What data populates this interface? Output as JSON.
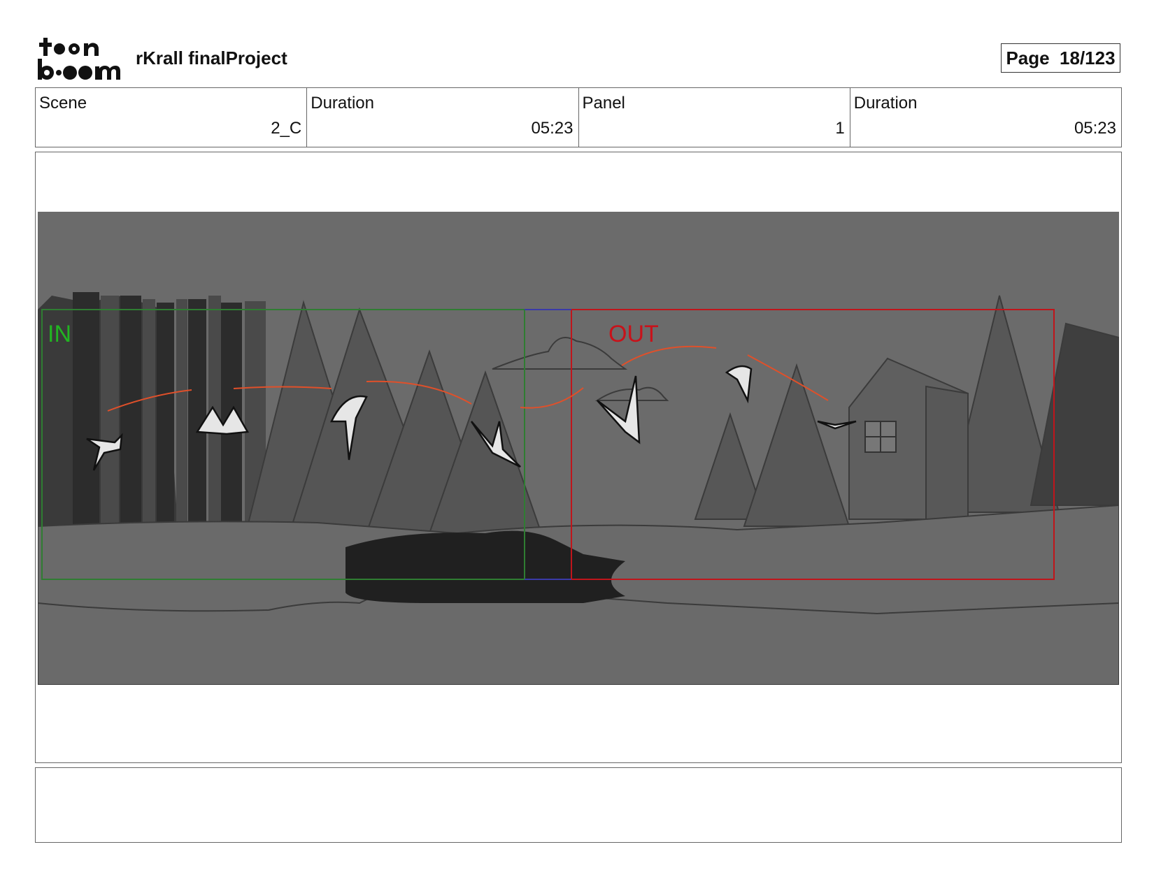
{
  "header": {
    "project_title": "rKrall finalProject",
    "page_label": "Page  18/123",
    "logo_text": "toonboom"
  },
  "info": [
    {
      "label": "Scene",
      "value": "2_C"
    },
    {
      "label": "Duration",
      "value": "05:23"
    },
    {
      "label": "Panel",
      "value": "1"
    },
    {
      "label": "Duration",
      "value": "05:23"
    }
  ],
  "panel": {
    "in_label": "IN",
    "out_label": "OUT",
    "colors": {
      "in_frame": "#2f7d32",
      "out_frame": "#c0151b",
      "in_text": "#22b422",
      "out_text": "#c8121a",
      "motion_path": "#e0502a",
      "background": "#6b6b6b"
    }
  },
  "notes": {
    "text": ""
  }
}
